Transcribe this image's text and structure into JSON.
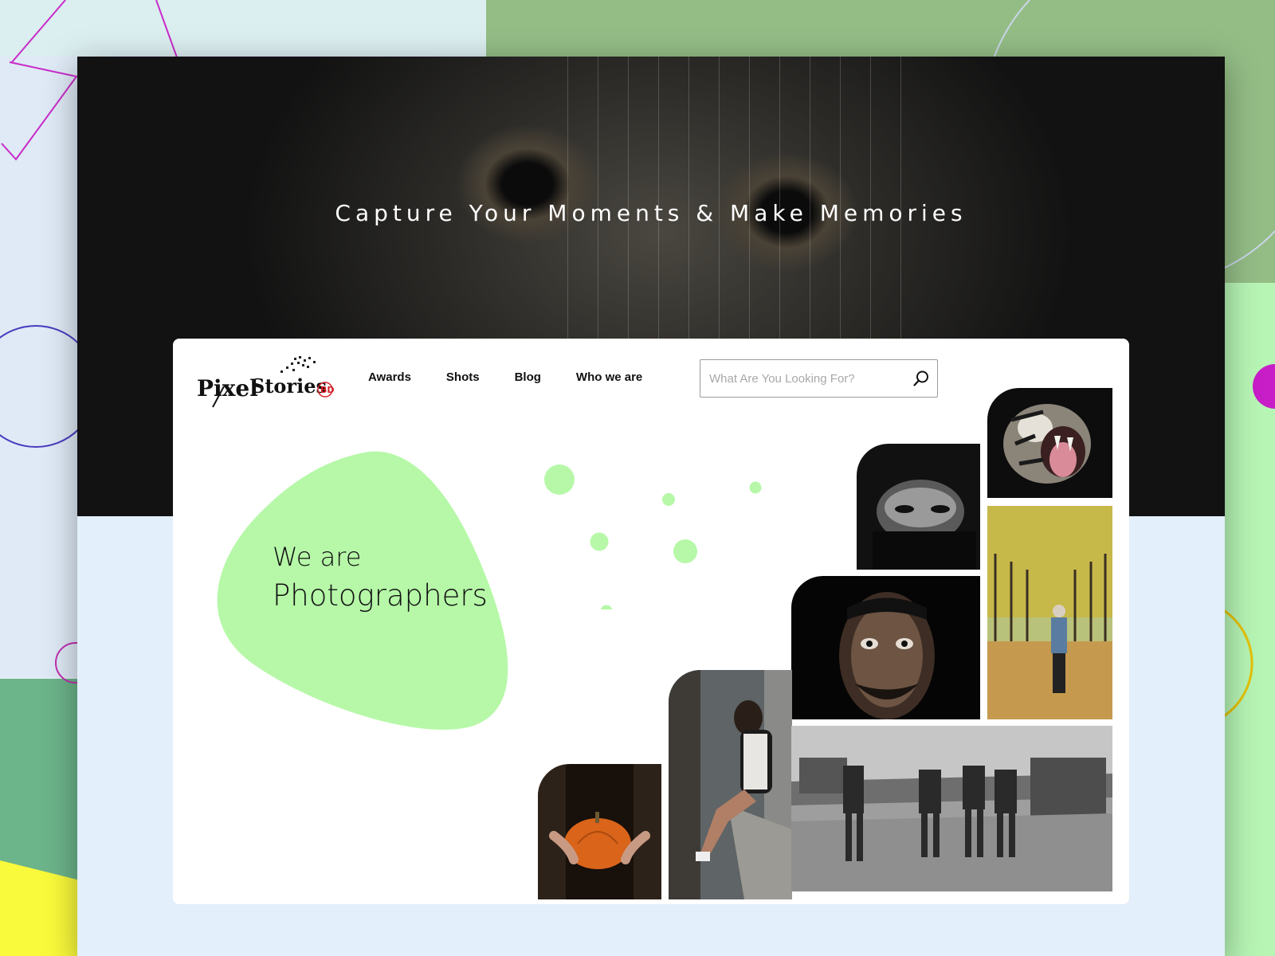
{
  "hero": {
    "title": "Capture Your Moments & Make Memories"
  },
  "logo": {
    "text_pixel": "Pixel",
    "text_stories": "Stories",
    "text_bd": "BD"
  },
  "nav": {
    "items": [
      {
        "label": "Awards"
      },
      {
        "label": "Shots"
      },
      {
        "label": "Blog"
      },
      {
        "label": "Who we are"
      }
    ]
  },
  "search": {
    "placeholder": "What Are You Looking For?",
    "icon": "search-icon"
  },
  "headline": {
    "line1": "We are",
    "line2": "Photographers"
  },
  "colors": {
    "accent_green": "#b6f8a8",
    "hero_dark": "#1a1a1a",
    "magenta": "#c81ec8"
  }
}
